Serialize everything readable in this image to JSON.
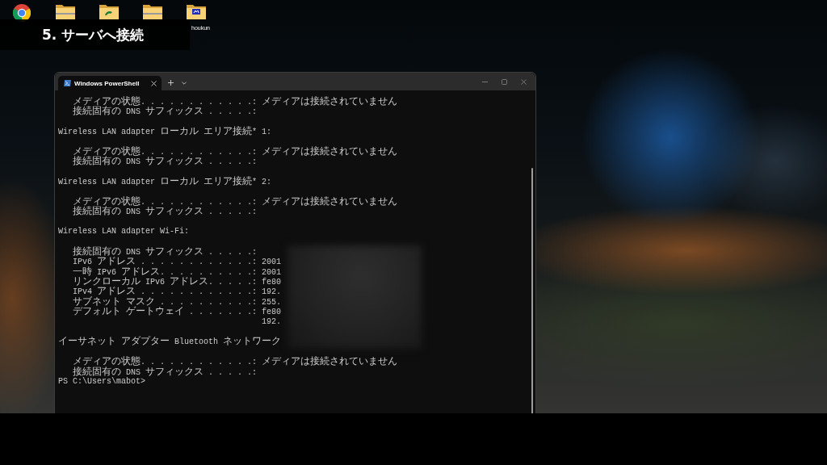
{
  "desktop": {
    "icons": [
      {
        "kind": "browser"
      },
      {
        "kind": "zip"
      },
      {
        "kind": "folder"
      },
      {
        "kind": "zip"
      },
      {
        "kind": "app",
        "label": "houkun"
      }
    ]
  },
  "caption": {
    "title": "5. サーバへ接続"
  },
  "terminal": {
    "tabs": [
      {
        "title": "Windows PowerShell",
        "selected": true
      }
    ],
    "sections": [
      {
        "entries": [
          {
            "kind": "field",
            "label": "メディアの状態. . . . . . . . . . . .:",
            "value": "メディアは接続されていません"
          },
          {
            "kind": "field",
            "label": "接続固有の DNS サフィックス . . . . .:"
          }
        ]
      },
      {
        "header": "Wireless LAN adapter ローカル エリア接続* 1:",
        "entries": [
          {
            "kind": "field",
            "label": "メディアの状態. . . . . . . . . . . .:",
            "value": "メディアは接続されていません"
          },
          {
            "kind": "field",
            "label": "接続固有の DNS サフィックス . . . . .:"
          }
        ]
      },
      {
        "header": "Wireless LAN adapter ローカル エリア接続* 2:",
        "entries": [
          {
            "kind": "field",
            "label": "メディアの状態. . . . . . . . . . . .:",
            "value": "メディアは接続されていません"
          },
          {
            "kind": "field",
            "label": "接続固有の DNS サフィックス . . . . .:"
          }
        ]
      },
      {
        "header": "Wireless LAN adapter Wi-Fi:",
        "entries": [
          {
            "kind": "field",
            "label": "接続固有の DNS サフィックス . . . . .:"
          },
          {
            "kind": "field",
            "label": "IPv6 アドレス . . . . . . . . . . . .:",
            "value": "2001"
          },
          {
            "kind": "field",
            "label": "一時 IPv6 アドレス. . . . . . . . . .:",
            "value": "2001"
          },
          {
            "kind": "field",
            "label": "リンクローカル IPv6 アドレス. . . . .:",
            "value": "fe80"
          },
          {
            "kind": "field",
            "label": "IPv4 アドレス . . . . . . . . . . . .:",
            "value": "192."
          },
          {
            "kind": "field",
            "label": "サブネット マスク . . . . . . . . . .:",
            "value": "255."
          },
          {
            "kind": "field",
            "label": "デフォルト ゲートウェイ . . . . . . .:",
            "value": "fe80"
          },
          {
            "kind": "continuation",
            "value": "192."
          }
        ]
      },
      {
        "header": "イーサネット アダプター Bluetooth ネットワーク",
        "entries": [
          {
            "kind": "field",
            "label": "メディアの状態. . . . . . . . . . . .:",
            "value": "メディアは接続されていません"
          },
          {
            "kind": "field",
            "label": "接続固有の DNS サフィックス . . . . .:"
          }
        ]
      }
    ],
    "prompt": "PS C:\\Users\\mabot>"
  }
}
